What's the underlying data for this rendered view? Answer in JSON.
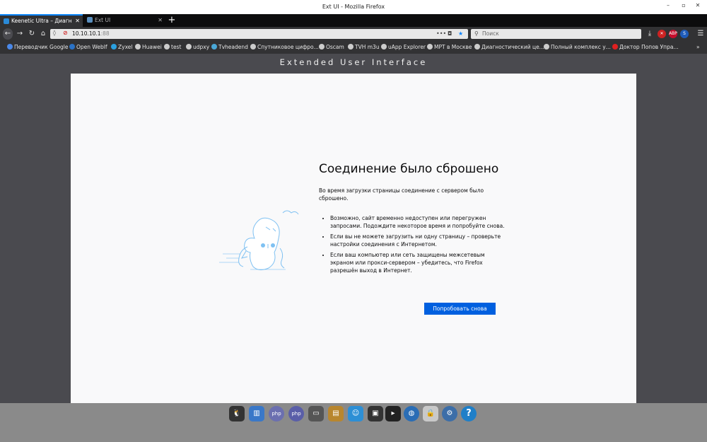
{
  "window": {
    "title": "Ext UI - Mozilla Firefox",
    "controls": [
      "–",
      "▫",
      "✕"
    ]
  },
  "tabs": [
    {
      "label": "Keenetic Ultra – Диагнос",
      "active": true,
      "icon": "keenetic-favicon"
    },
    {
      "label": "Ext UI",
      "active": false,
      "icon": "extui-favicon"
    }
  ],
  "newtab_label": "+",
  "navbar": {
    "back": "←",
    "forward": "→",
    "reload": "↻",
    "home": "⌂",
    "url_host": "10.10.10.1",
    "url_port": ":88",
    "page_actions": "•••",
    "search_placeholder": "Поиск",
    "download": "⤓",
    "menu": "☰",
    "overflow": "»"
  },
  "extensions": [
    {
      "label": "✕",
      "color": "#cc2222"
    },
    {
      "label": "ABP",
      "color": "#c70d2c"
    },
    {
      "label": "S",
      "color": "#1e5bb8"
    }
  ],
  "bookmarks": [
    {
      "label": "Переводчик Google",
      "color": "#4a88e8"
    },
    {
      "label": "Open WebIf",
      "color": "#2a72c6"
    },
    {
      "label": "Zyxel",
      "color": "#2aa0e0"
    },
    {
      "label": "Huawei",
      "color": "#cccccc"
    },
    {
      "label": "test",
      "color": "#cccccc"
    },
    {
      "label": "udpxy",
      "color": "#cccccc"
    },
    {
      "label": "Tvheadend",
      "color": "#4aa8d8"
    },
    {
      "label": "Спутниковое цифро...",
      "color": "#cccccc"
    },
    {
      "label": "Oscam",
      "color": "#cccccc"
    },
    {
      "label": "TVH m3u",
      "color": "#cccccc"
    },
    {
      "label": "uApp Explorer",
      "color": "#cccccc"
    },
    {
      "label": "МРТ в Москве",
      "color": "#cccccc"
    },
    {
      "label": "Диагностический це...",
      "color": "#cccccc"
    },
    {
      "label": "Полный комплекс у...",
      "color": "#cccccc"
    },
    {
      "label": "Доктор Попов Упра...",
      "color": "#e02020"
    }
  ],
  "page": {
    "header": "Extended User Interface",
    "error": {
      "title": "Соединение было сброшено",
      "description": "Во время загрузки страницы соединение с сервером было сброшено.",
      "bullets": [
        "Возможно, сайт временно недоступен или перегружен запросами. Подождите некоторое время и попробуйте снова.",
        "Если вы не можете загрузить ни одну страницу – проверьте настройки соединения с Интернетом.",
        "Если ваш компьютер или сеть защищены межсетевым экраном или прокси-сервером – убедитесь, что Firefox разрешён выход в Интернет."
      ],
      "retry_button": "Попробовать снова"
    }
  },
  "dock": [
    {
      "name": "dock-linux-icon",
      "color": "#333333",
      "glyph": "🐧"
    },
    {
      "name": "dock-stats-icon",
      "color": "#3a78c8",
      "glyph": "▥"
    },
    {
      "name": "dock-php-icon",
      "color": "#6b6fb0",
      "glyph": "php"
    },
    {
      "name": "dock-phpinfo-icon",
      "color": "#5a5ea8",
      "glyph": "php"
    },
    {
      "name": "dock-drive-icon",
      "color": "#555555",
      "glyph": "▭"
    },
    {
      "name": "dock-package-icon",
      "color": "#b8862e",
      "glyph": "▤"
    },
    {
      "name": "dock-finder-icon",
      "color": "#2d8fd5",
      "glyph": "☺"
    },
    {
      "name": "dock-monitor-icon",
      "color": "#333333",
      "glyph": "▣"
    },
    {
      "name": "dock-terminal-icon",
      "color": "#222222",
      "glyph": "▸"
    },
    {
      "name": "dock-globe-icon",
      "color": "#2a6db5",
      "glyph": "◍"
    },
    {
      "name": "dock-lock-icon",
      "color": "#c9c9c9",
      "glyph": "🔒"
    },
    {
      "name": "dock-settings-icon",
      "color": "#3c6ea8",
      "glyph": "⚙"
    },
    {
      "name": "dock-help-icon",
      "color": "#1f7fc8",
      "glyph": "?"
    }
  ]
}
